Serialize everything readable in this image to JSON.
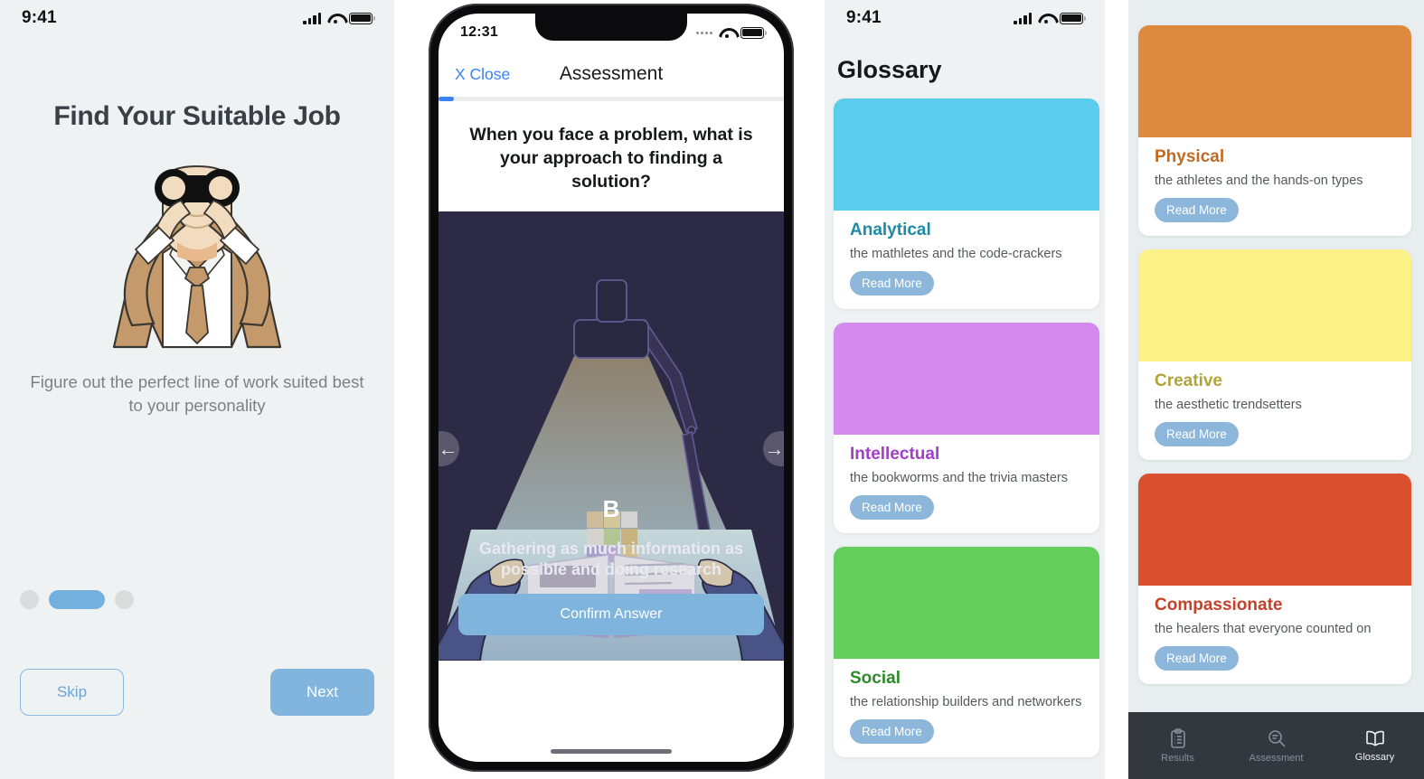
{
  "onboarding": {
    "status": {
      "time": "9:41",
      "signal": "cellular-bars-icon",
      "wifi": "wifi-icon",
      "battery": "battery-full-icon"
    },
    "title": "Find Your Suitable Job",
    "illustration": "person-with-binoculars-illustration",
    "subtitle": "Figure out the perfect line of work suited best to your personality",
    "pagination": {
      "count": 3,
      "active_index": 1
    },
    "skip_label": "Skip",
    "next_label": "Next",
    "colors": {
      "background": "#eef2f2",
      "accent": "#82b5dd",
      "dot_inactive": "#d8dcdc",
      "title": "#3a3f47"
    }
  },
  "assessment": {
    "status": {
      "time": "12:31",
      "signal": "cellular-dots-icon",
      "wifi": "wifi-icon",
      "battery": "battery-full-icon"
    },
    "close_label": "X Close",
    "title": "Assessment",
    "progress_percent": 4.5,
    "question": "When you face a problem, what is your approach to finding a solution?",
    "illustration": "desk-lamp-book-and-hands-illustration",
    "prev_arrow": "arrow-left-icon",
    "next_arrow": "arrow-right-icon",
    "choice_letter": "B",
    "choice_caption": "Gathering as much information as possible and doing research",
    "confirm_label": "Confirm Answer",
    "colors": {
      "illustration_bg": "#2e2b45",
      "progress": "#3b82f6",
      "confirm": "#7fb4dd",
      "close": "#3b82f6"
    }
  },
  "glossary": {
    "status": {
      "time": "9:41",
      "signal": "cellular-bars-icon",
      "wifi": "wifi-icon",
      "battery": "battery-full-icon"
    },
    "title": "Glossary",
    "read_more_label": "Read More",
    "cards_left": [
      {
        "name": "Analytical",
        "desc": "the mathletes and the code-crackers",
        "swatch": "#5BCDEC",
        "name_color": "#1f8aa5"
      },
      {
        "name": "Intellectual",
        "desc": "the bookworms and the trivia masters",
        "swatch": "#D389EE",
        "name_color": "#a23ec9"
      },
      {
        "name": "Social",
        "desc": "the relationship builders and networkers",
        "swatch": "#63CE5B",
        "name_color": "#2f8a2a"
      }
    ],
    "cards_right": [
      {
        "name": "Physical",
        "desc": "the athletes and the hands-on types",
        "swatch": "#DD8A3E",
        "name_color": "#c06a22"
      },
      {
        "name": "Creative",
        "desc": "the aesthetic trendsetters",
        "swatch": "#FCF287",
        "name_color": "#b0a43a"
      },
      {
        "name": "Compassionate",
        "desc": "the healers that everyone counted on",
        "swatch": "#DA502F",
        "name_color": "#c4412a"
      }
    ],
    "tabs": [
      {
        "label": "Results",
        "icon": "clipboard-icon",
        "active": false
      },
      {
        "label": "Assessment",
        "icon": "magnifier-icon",
        "active": false
      },
      {
        "label": "Glossary",
        "icon": "open-book-icon",
        "active": true
      }
    ],
    "colors": {
      "background": "#eef2f2",
      "card": "#ffffff",
      "button": "#8cb7da",
      "tabbar": "#33383f"
    }
  }
}
